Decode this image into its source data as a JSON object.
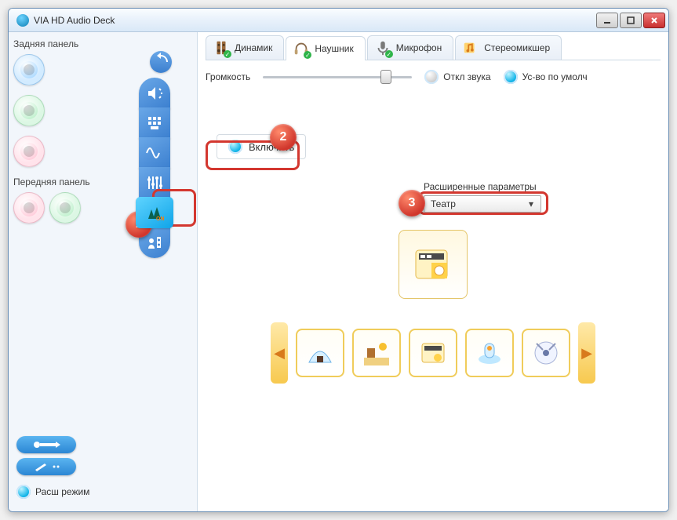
{
  "window": {
    "title": "VIA HD Audio Deck"
  },
  "sidebar": {
    "rear_label": "Задняя панель",
    "front_label": "Передняя панель",
    "mode_button_label": "Расш режим"
  },
  "tabs": {
    "speaker": "Динамик",
    "headphone": "Наушник",
    "microphone": "Микрофон",
    "stereomix": "Стереомикшер"
  },
  "main": {
    "volume_label": "Громкость",
    "mute_label": "Откл звука",
    "default_device_label": "Ус-во по умолч",
    "enable_label": "Включить",
    "advanced_label": "Расширенные параметры",
    "select_value": "Театр"
  },
  "callouts": {
    "b1": "1",
    "b2": "2",
    "b3": "3"
  }
}
